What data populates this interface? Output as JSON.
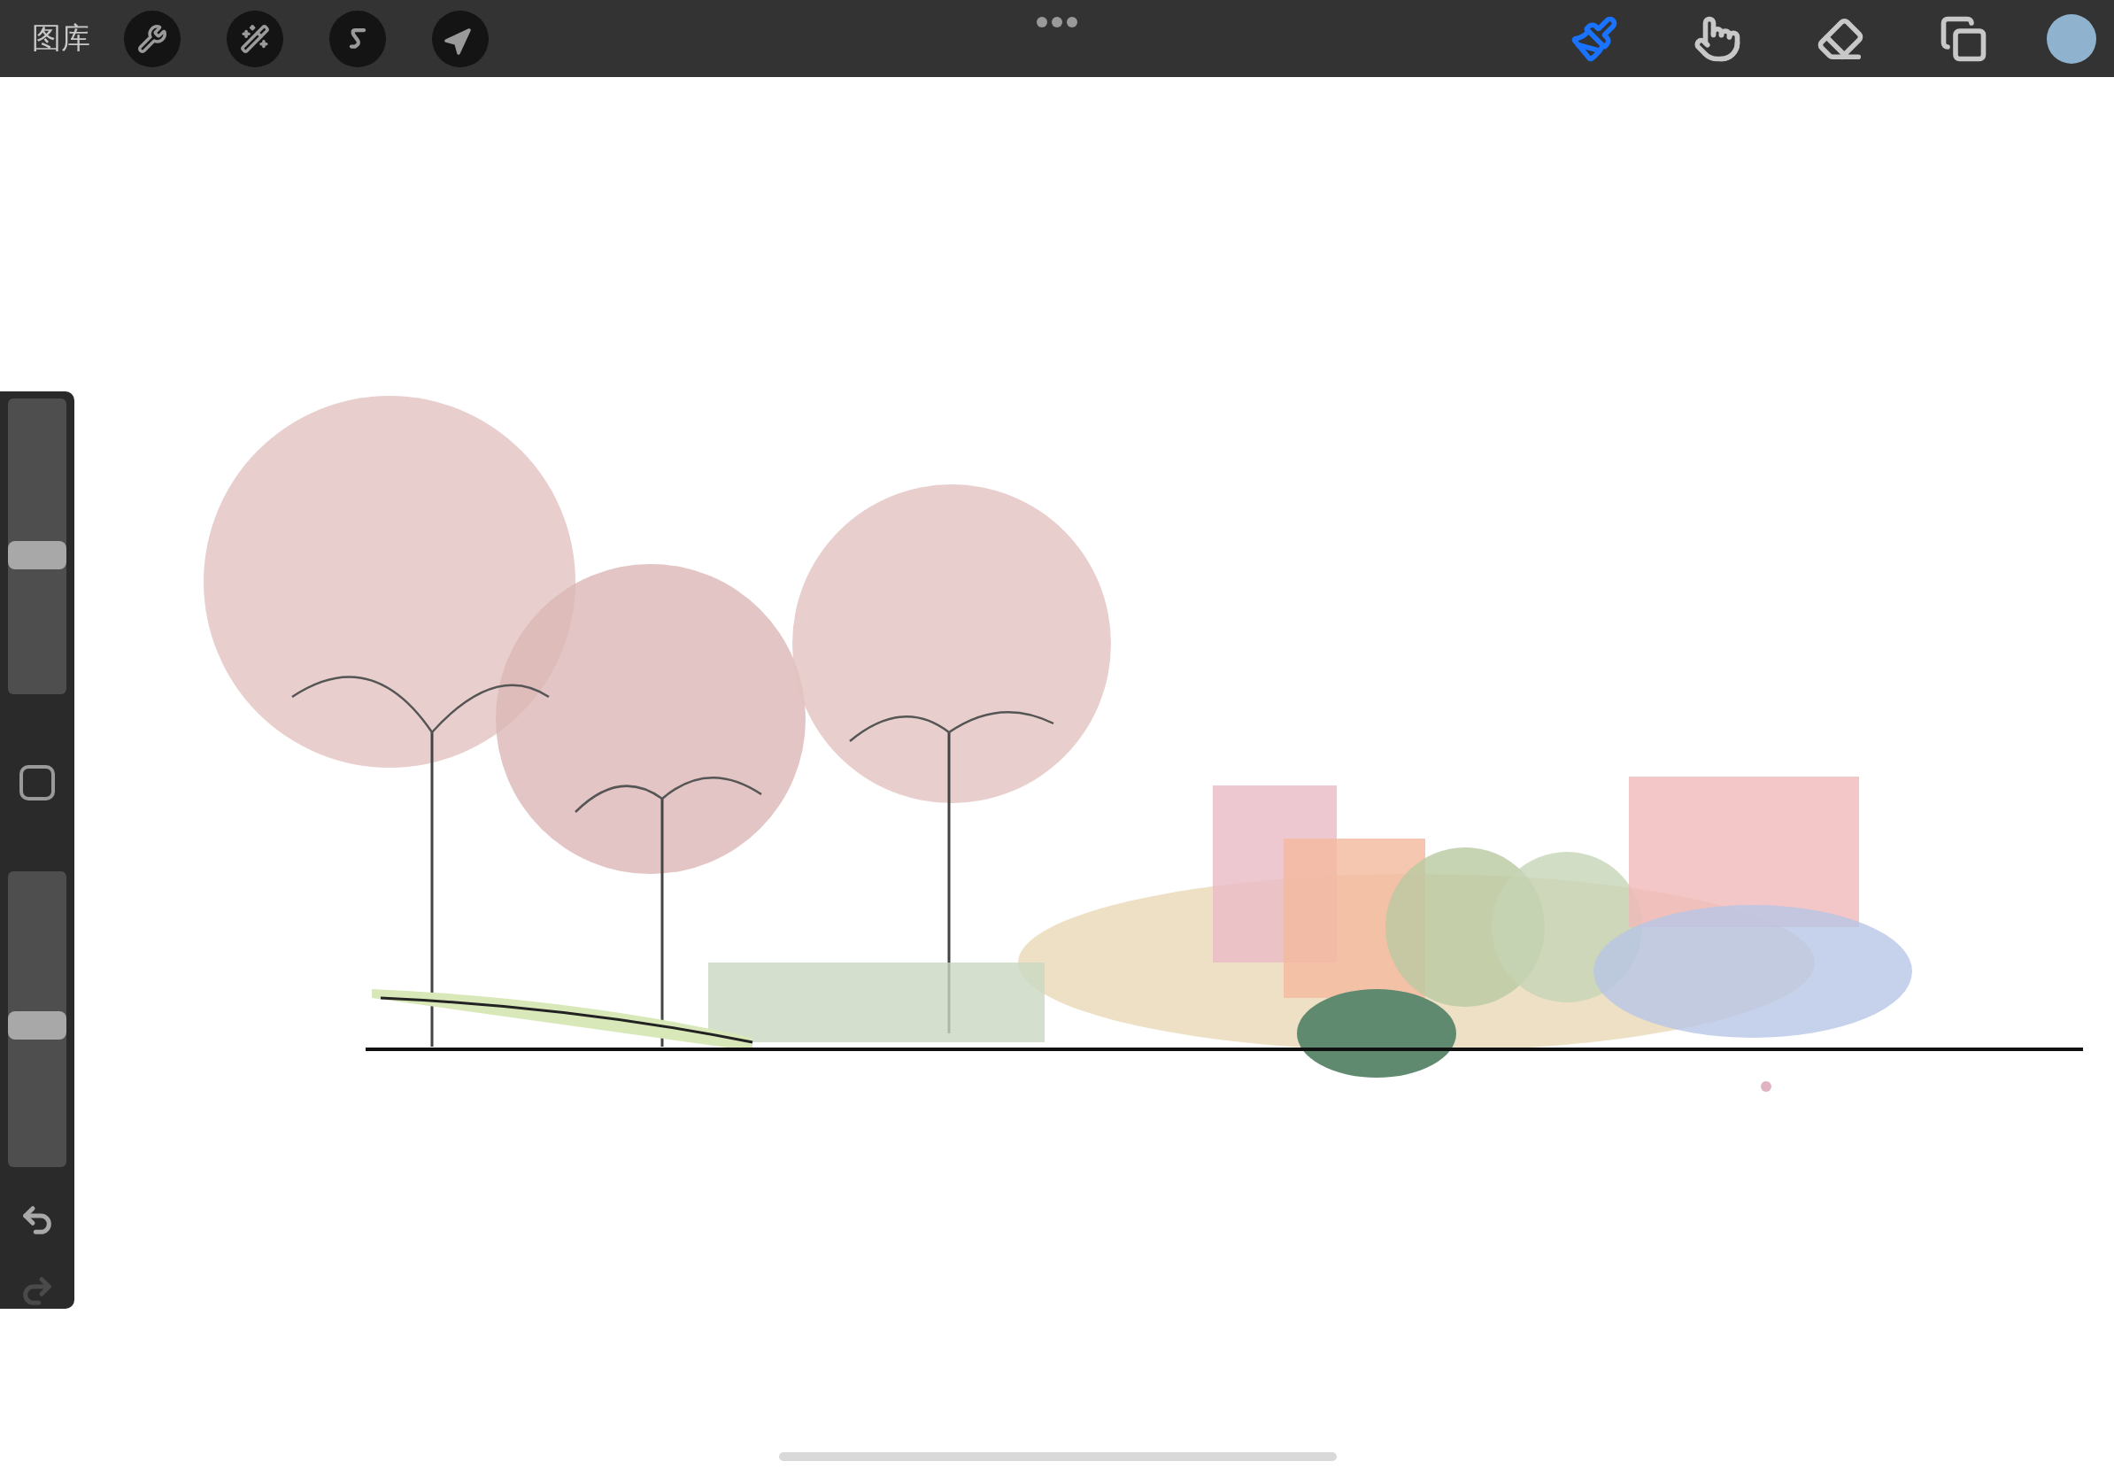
{
  "top_bar": {
    "gallery_label": "图库",
    "left_tools": [
      {
        "kind": "wrench",
        "selected": false
      },
      {
        "kind": "wand",
        "selected": false
      },
      {
        "kind": "selection",
        "selected": false
      },
      {
        "kind": "transform",
        "selected": false
      }
    ],
    "right_tools": [
      {
        "kind": "brush",
        "selected": true
      },
      {
        "kind": "smudge",
        "selected": false
      },
      {
        "kind": "eraser",
        "selected": false
      },
      {
        "kind": "layers",
        "selected": false
      }
    ],
    "color_swatch": {
      "color": "#8fb3cf"
    }
  },
  "sidebar": {
    "brush_size": {
      "level": 0.47
    },
    "opacity": {
      "level": 0.48
    },
    "undo": {
      "disabled": false
    },
    "redo": {
      "disabled": true
    }
  }
}
